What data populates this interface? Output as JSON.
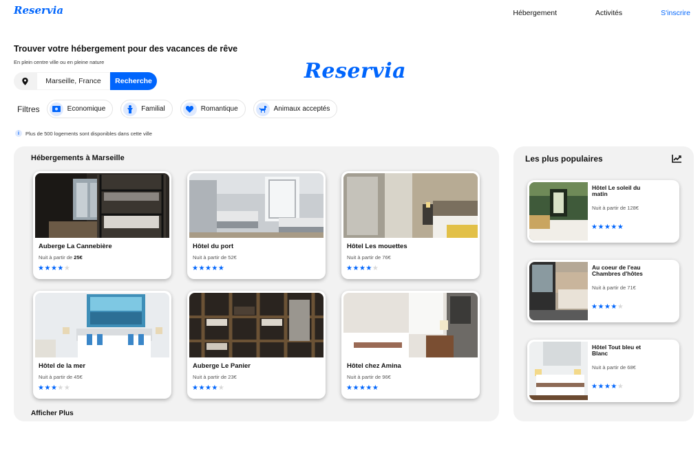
{
  "brand": {
    "logo": "Reservia",
    "logo_big": "Reservia"
  },
  "nav": {
    "items": [
      "Hébergement",
      "Activités"
    ],
    "signup": "S'inscrire"
  },
  "hero": {
    "title": "Trouver votre hébergement pour des vacances de rêve",
    "subtitle": "En plein centre ville ou en pleine nature"
  },
  "search": {
    "location": "Marseille, France",
    "button": "Recherche",
    "pin_icon": "map-pin-icon"
  },
  "filters": {
    "label": "Filtres",
    "items": [
      {
        "label": "Economique",
        "icon": "money-icon"
      },
      {
        "label": "Familial",
        "icon": "child-icon"
      },
      {
        "label": "Romantique",
        "icon": "heart-icon"
      },
      {
        "label": "Animaux acceptés",
        "icon": "dog-icon"
      }
    ]
  },
  "info": {
    "icon": "info-icon",
    "text": "Plus de 500 logements sont disponibles dans cette ville"
  },
  "accommodations": {
    "title": "Hébergements à Marseille",
    "more": "Afficher Plus",
    "price_prefix": "Nuit à partir de ",
    "items": [
      {
        "name": "Auberge La Cannebière",
        "price": "25€",
        "rating": 4
      },
      {
        "name": "Hôtel du port",
        "price": "52€",
        "rating": 5
      },
      {
        "name": "Hôtel Les mouettes",
        "price": "76€",
        "rating": 4
      },
      {
        "name": "Hôtel de la mer",
        "price": "45€",
        "rating": 3
      },
      {
        "name": "Auberge Le Panier",
        "price": "23€",
        "rating": 4
      },
      {
        "name": "Hôtel chez Amina",
        "price": "96€",
        "rating": 5
      }
    ]
  },
  "popular": {
    "title": "Les plus populaires",
    "icon": "trend-chart-icon",
    "items": [
      {
        "name": "Hôtel Le soleil du matin",
        "price": "Nuit à partir de 128€",
        "rating": 5
      },
      {
        "name": "Au coeur de l'eau Chambres d'hôtes",
        "price": "Nuit à partir de 71€",
        "rating": 4
      },
      {
        "name": "Hôtel Tout bleu et Blanc",
        "price": "Nuit à partir de 68€",
        "rating": 4
      }
    ]
  },
  "colors": {
    "accent": "#0065fc",
    "accent_light": "#dee9fe",
    "panel": "#f2f2f2",
    "star_off": "#d8d8d8"
  }
}
